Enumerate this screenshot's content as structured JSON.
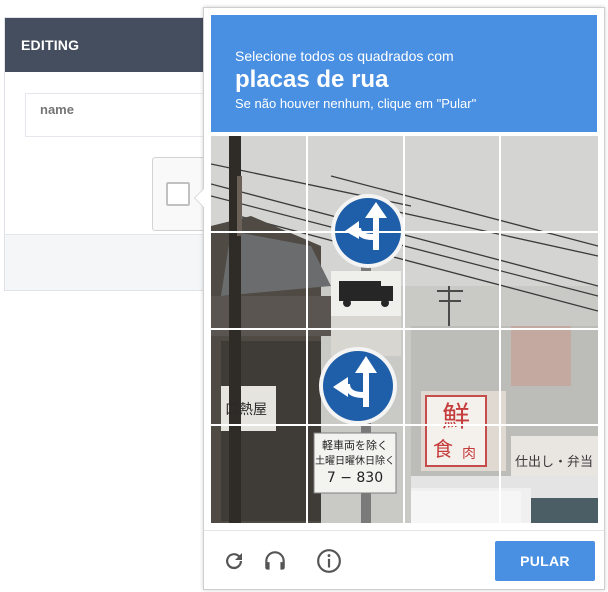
{
  "editor": {
    "header_title": "EDITING",
    "name_field": {
      "placeholder": "name",
      "value": ""
    }
  },
  "challenge": {
    "instruction_line1": "Selecione todos os quadrados com",
    "instruction_keyword": "placas de rua",
    "instruction_line3": "Se não houver nenhum, clique em \"Pular\"",
    "image": {
      "sign_top_text_line1": "軽車両を除く",
      "sign_top_text_line2": "土曜日曜休日除く",
      "sign_top_text_line3": "7 − 830",
      "shop_sign_left": "口熱屋",
      "shop_sign_right": "仕出し・弁当",
      "shop_sign_big": "鮮",
      "shop_sign_small": "食",
      "shop_sign_tag": "肉"
    },
    "grid": {
      "rows": 4,
      "cols": 4
    },
    "footer": {
      "reload_icon": "reload-icon",
      "audio_icon": "headphones-icon",
      "info_icon": "info-icon",
      "skip_label": "PULAR"
    }
  },
  "colors": {
    "header_dark": "#454e5f",
    "recaptcha_blue": "#4a90e2"
  }
}
